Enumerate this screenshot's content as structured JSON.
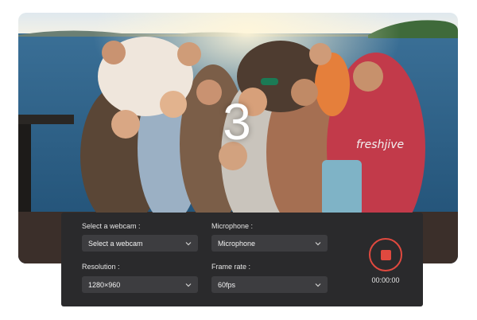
{
  "preview": {
    "countdown": "3",
    "shirt_text": "freshjive"
  },
  "controls": {
    "webcam": {
      "label": "Select a webcam :",
      "value": "Select a  webcam"
    },
    "microphone": {
      "label": "Microphone :",
      "value": "Microphone"
    },
    "resolution": {
      "label": "Resolution :",
      "value": "1280×960"
    },
    "frame_rate": {
      "label": "Frame rate :",
      "value": "60fps"
    },
    "timer": "00:00:00"
  },
  "icons": {
    "record": "stop-square-icon",
    "dropdown": "chevron-down-icon"
  },
  "colors": {
    "panel": "#2a2a2c",
    "select": "#3d3d40",
    "record_accent": "#e0493f"
  }
}
